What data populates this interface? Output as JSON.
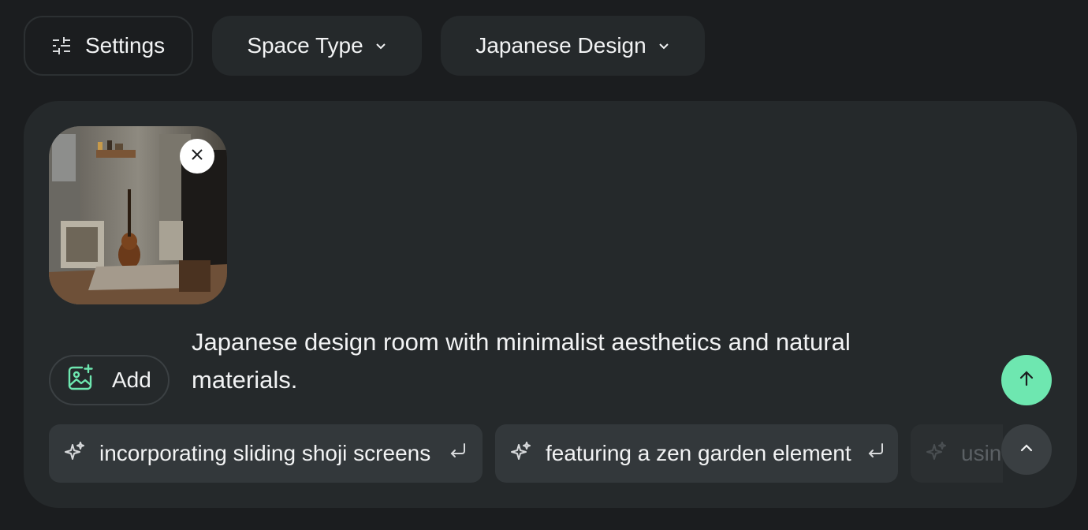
{
  "toolbar": {
    "settings_label": "Settings",
    "space_type_label": "Space Type",
    "style_label": "Japanese Design"
  },
  "upload": {
    "image_icon": "room-photo",
    "close_icon": "close-icon"
  },
  "composer": {
    "add_label": "Add",
    "prompt_text": "Japanese design room with minimalist aesthetics and natural materials."
  },
  "suggestions": [
    {
      "label": "incorporating sliding shoji screens"
    },
    {
      "label": "featuring a zen garden element"
    },
    {
      "label": "usin"
    }
  ],
  "colors": {
    "background": "#1b1d1f",
    "panel": "#25292b",
    "chip": "#33383b",
    "accent": "#6ee7b0"
  }
}
